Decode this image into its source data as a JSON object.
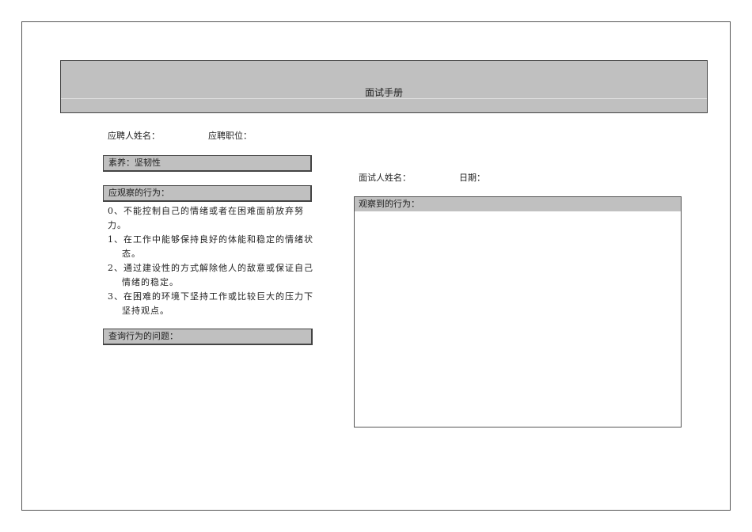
{
  "header": {
    "title": "面试手册"
  },
  "left": {
    "candidate_name_label": "应聘人姓名：",
    "position_label": "应聘职位：",
    "competency_label": "素养：坚韧性",
    "behaviors_label": "应观察的行为：",
    "behaviors": [
      "0、不能控制自己的情绪或者在困难面前放弃努力。",
      "1、在工作中能够保持良好的体能和稳定的情绪状态。",
      "2、通过建设性的方式解除他人的敌意或保证自己情绪的稳定。",
      "3、在困难的环境下坚持工作或比较巨大的压力下坚持观点。"
    ],
    "questions_label": "查询行为的问题："
  },
  "right": {
    "interviewer_label": "面试人姓名：",
    "date_label": "日期：",
    "observed_label": "观察到的行为："
  }
}
